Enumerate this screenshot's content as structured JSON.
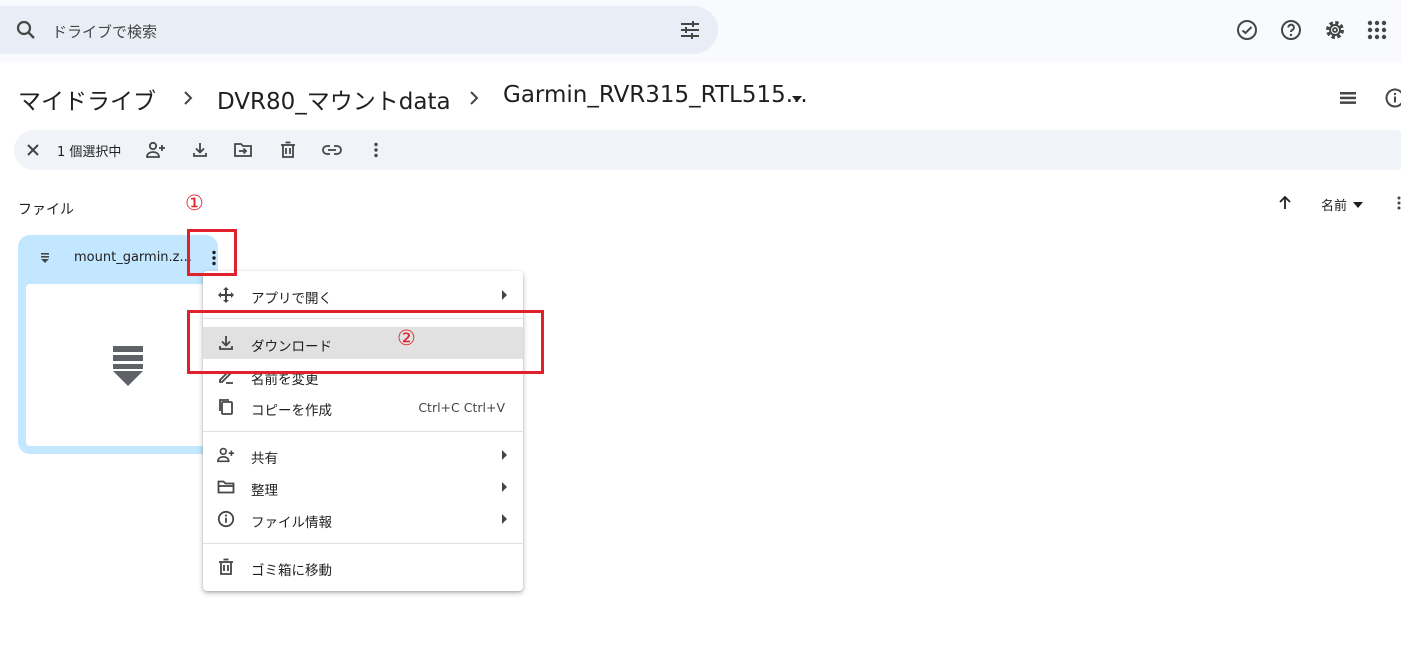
{
  "search": {
    "placeholder": "ドライブで検索"
  },
  "header_icons": [
    "support-check-icon",
    "help-icon",
    "settings-icon",
    "apps-icon"
  ],
  "breadcrumb": [
    "マイドライブ",
    "DVR80_マウントdata",
    "Garmin_RVR315_RTL515..."
  ],
  "toolbar": {
    "selected_count": "1 個選択中"
  },
  "files_section": {
    "label": "ファイル",
    "sort_label": "名前"
  },
  "file": {
    "name": "mount_garmin.z..."
  },
  "context_menu": {
    "items": [
      {
        "label": "アプリで開く",
        "icon": "open-with-icon",
        "submenu": true
      },
      {
        "label": "ダウンロード",
        "icon": "download-icon",
        "highlighted": true
      },
      {
        "label": "名前を変更",
        "icon": "rename-icon"
      },
      {
        "label": "コピーを作成",
        "icon": "copy-icon",
        "shortcut": "Ctrl+C Ctrl+V"
      },
      {
        "label": "共有",
        "icon": "share-icon",
        "submenu": true
      },
      {
        "label": "整理",
        "icon": "folder-icon",
        "submenu": true
      },
      {
        "label": "ファイル情報",
        "icon": "info-icon",
        "submenu": true
      },
      {
        "label": "ゴミ箱に移動",
        "icon": "trash-icon"
      }
    ]
  },
  "annotations": {
    "step1": "①",
    "step2": "②",
    "color": "#e0202a"
  },
  "colors": {
    "card_selected": "#c2e7ff",
    "search_bg": "#e9eef6",
    "toolbar_bg": "#f0f4f9"
  }
}
